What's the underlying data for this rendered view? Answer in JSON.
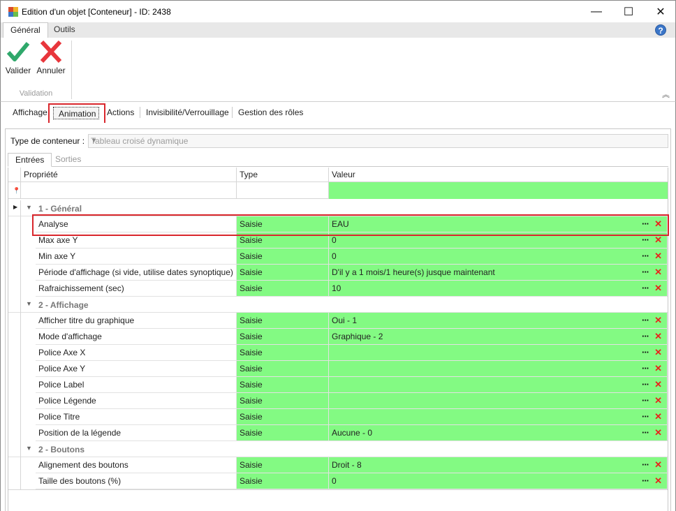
{
  "window": {
    "title": "Edition d'un objet [Conteneur] - ID: 2438",
    "minimize": "—",
    "maximize": "☐",
    "close": "✕"
  },
  "ribbon": {
    "tabs": [
      "Général",
      "Outils"
    ],
    "help": "?",
    "buttons": {
      "valider": "Valider",
      "annuler": "Annuler"
    },
    "group_label": "Validation",
    "collapse": "︽"
  },
  "page_tabs": [
    "Affichage",
    "Animation",
    "Actions",
    "Invisibilité/Verrouillage",
    "Gestion des rôles"
  ],
  "container_type": {
    "label": "Type de conteneur :",
    "value": "Tableau croisé dynamique"
  },
  "sub_tabs": [
    "Entrées",
    "Sorties"
  ],
  "grid": {
    "headers": {
      "property": "Propriété",
      "type": "Type",
      "value": "Valeur"
    },
    "groups": [
      {
        "label": "1 - Général",
        "rows": [
          {
            "property": "Analyse",
            "type": "Saisie",
            "value": "EAU"
          },
          {
            "property": "Max axe Y",
            "type": "Saisie",
            "value": "0"
          },
          {
            "property": "Min axe Y",
            "type": "Saisie",
            "value": "0"
          },
          {
            "property": "Période d'affichage (si vide, utilise dates synoptique)",
            "type": "Saisie",
            "value": "D'il y a 1 mois/1 heure(s) jusque maintenant"
          },
          {
            "property": "Rafraichissement (sec)",
            "type": "Saisie",
            "value": "10"
          }
        ]
      },
      {
        "label": "2 - Affichage",
        "rows": [
          {
            "property": "Afficher titre du graphique",
            "type": "Saisie",
            "value": "Oui - 1"
          },
          {
            "property": "Mode d'affichage",
            "type": "Saisie",
            "value": "Graphique - 2"
          },
          {
            "property": "Police Axe X",
            "type": "Saisie",
            "value": ""
          },
          {
            "property": "Police Axe Y",
            "type": "Saisie",
            "value": ""
          },
          {
            "property": "Police Label",
            "type": "Saisie",
            "value": ""
          },
          {
            "property": "Police Légende",
            "type": "Saisie",
            "value": ""
          },
          {
            "property": "Police Titre",
            "type": "Saisie",
            "value": ""
          },
          {
            "property": "Position de la légende",
            "type": "Saisie",
            "value": "Aucune - 0"
          }
        ]
      },
      {
        "label": "2 - Boutons",
        "rows": [
          {
            "property": "Alignement des boutons",
            "type": "Saisie",
            "value": "Droit - 8"
          },
          {
            "property": "Taille des boutons (%)",
            "type": "Saisie",
            "value": "0"
          }
        ]
      }
    ],
    "row_actions": {
      "edit": "···",
      "delete": "✕"
    }
  },
  "colors": {
    "cell_green": "#83fa83",
    "highlight_red": "#d9262c",
    "delete_red": "#e8231b",
    "valider_green": "#2fa86b",
    "annuler_red": "#e8363c"
  }
}
